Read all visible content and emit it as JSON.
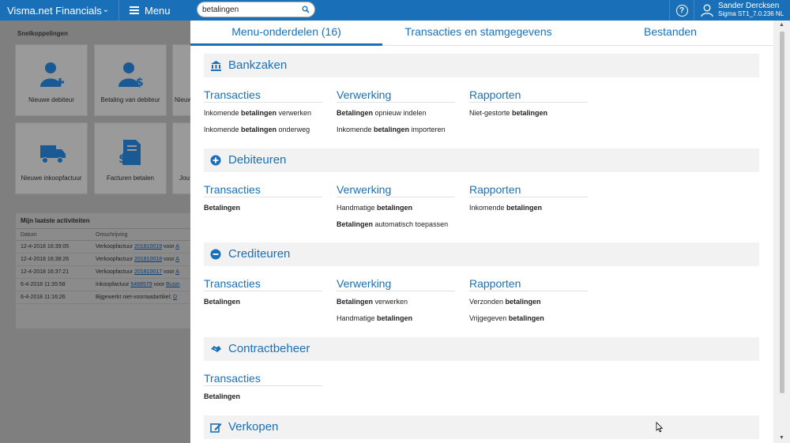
{
  "header": {
    "brand": "Visma.net Financials",
    "menu_label": "Menu",
    "help_label": "?",
    "user_name": "Sander Dercksen",
    "user_company": "Sigma ST1_7.0.236 NL"
  },
  "search": {
    "value": "betalingen"
  },
  "workspace": {
    "shortcuts_title": "Snelkoppelingen",
    "tiles": [
      {
        "label": "Nieuwe debiteur",
        "icon": "add-person-icon"
      },
      {
        "label": "Betaling van debiteur",
        "icon": "person-money-icon"
      },
      {
        "label": "Nieuw",
        "icon": "unknown-icon"
      },
      {
        "label": "Nieuwe inkoopfactuur",
        "icon": "truck-icon"
      },
      {
        "label": "Facturen betalen",
        "icon": "invoice-money-icon"
      },
      {
        "label": "Jou",
        "icon": "unknown-icon"
      }
    ],
    "activity": {
      "title": "Mijn laatste activiteiten",
      "col_date": "Datum",
      "col_desc": "Omschrijving",
      "rows": [
        {
          "date": "12-4-2018 16:39:05",
          "prefix": "Verkoopfactuur",
          "link": "201810019",
          "suffix": "voor",
          "link2": "A"
        },
        {
          "date": "12-4-2018 16:38:26",
          "prefix": "Verkoopfactuur",
          "link": "201810018",
          "suffix": "voor",
          "link2": "A"
        },
        {
          "date": "12-4-2018 16:37:21",
          "prefix": "Verkoopfactuur",
          "link": "201810017",
          "suffix": "voor",
          "link2": "A"
        },
        {
          "date": "6-4-2018 11:35:58",
          "prefix": "Inkoopfactuur",
          "link": "5468579",
          "suffix": "voor",
          "link2": "Busin"
        },
        {
          "date": "6-4-2018 11:16:26",
          "prefix": "Bijgewerkt niet-voorraadartikel:",
          "link": "",
          "suffix": "",
          "link2": "D"
        }
      ]
    }
  },
  "tabs": [
    {
      "label": "Menu-onderdelen  (16)",
      "active": true
    },
    {
      "label": "Transacties en stamgegevens",
      "active": false
    },
    {
      "label": "Bestanden",
      "active": false
    }
  ],
  "sections": [
    {
      "title": "Bankzaken",
      "icon": "bank-icon",
      "columns": [
        {
          "title": "Transacties",
          "items": [
            {
              "pre": "Inkomende ",
              "bold": "betalingen",
              "post": " verwerken"
            },
            {
              "pre": "Inkomende ",
              "bold": "betalingen",
              "post": " onderweg"
            }
          ]
        },
        {
          "title": "Verwerking",
          "items": [
            {
              "pre": "",
              "bold": "Betalingen",
              "post": " opnieuw indelen"
            },
            {
              "pre": "Inkomende ",
              "bold": "betalingen",
              "post": " importeren"
            }
          ]
        },
        {
          "title": "Rapporten",
          "items": [
            {
              "pre": "Niet-gestorte ",
              "bold": "betalingen",
              "post": ""
            }
          ]
        }
      ]
    },
    {
      "title": "Debiteuren",
      "icon": "plus-circle-icon",
      "columns": [
        {
          "title": "Transacties",
          "items": [
            {
              "pre": "",
              "bold": "Betalingen",
              "post": ""
            }
          ]
        },
        {
          "title": "Verwerking",
          "items": [
            {
              "pre": "Handmatige ",
              "bold": "betalingen",
              "post": ""
            },
            {
              "pre": "",
              "bold": "Betalingen",
              "post": " automatisch toepassen"
            }
          ]
        },
        {
          "title": "Rapporten",
          "items": [
            {
              "pre": "Inkomende ",
              "bold": "betalingen",
              "post": ""
            }
          ]
        }
      ]
    },
    {
      "title": "Crediteuren",
      "icon": "minus-circle-icon",
      "columns": [
        {
          "title": "Transacties",
          "items": [
            {
              "pre": "",
              "bold": "Betalingen",
              "post": ""
            }
          ]
        },
        {
          "title": "Verwerking",
          "items": [
            {
              "pre": "",
              "bold": "Betalingen",
              "post": " verwerken"
            },
            {
              "pre": "Handmatige ",
              "bold": "betalingen",
              "post": ""
            }
          ]
        },
        {
          "title": "Rapporten",
          "items": [
            {
              "pre": "Verzonden ",
              "bold": "betalingen",
              "post": ""
            },
            {
              "pre": "Vrijgegeven ",
              "bold": "betalingen",
              "post": ""
            }
          ]
        }
      ]
    },
    {
      "title": "Contractbeheer",
      "icon": "handshake-icon",
      "columns": [
        {
          "title": "Transacties",
          "items": [
            {
              "pre": "",
              "bold": "Betalingen",
              "post": ""
            }
          ]
        }
      ]
    },
    {
      "title": "Verkopen",
      "icon": "edit-icon",
      "columns": []
    }
  ],
  "colors": {
    "accent": "#1a70b8",
    "section_bg": "#f2f2f2",
    "overlay": "#7f7f7f"
  }
}
